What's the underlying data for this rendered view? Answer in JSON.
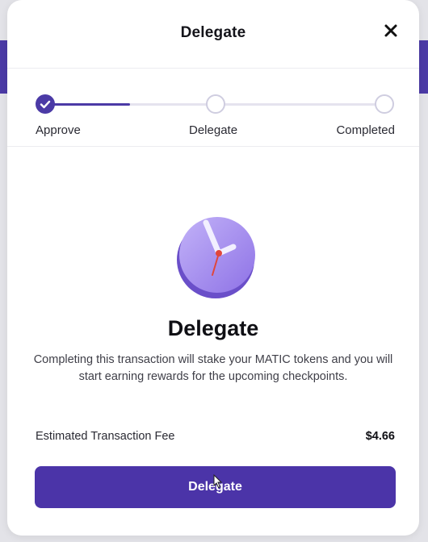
{
  "modal": {
    "title": "Delegate",
    "close_icon": "close-icon"
  },
  "stepper": {
    "steps": [
      {
        "label": "Approve",
        "status": "completed"
      },
      {
        "label": "Delegate",
        "status": "pending"
      },
      {
        "label": "Completed",
        "status": "pending"
      }
    ],
    "progress_fraction": 0.25
  },
  "content": {
    "illustration_icon": "clock-icon",
    "title": "Delegate",
    "description": "Completing this transaction will stake your MATIC tokens and you will start earning rewards for the upcoming checkpoints."
  },
  "fee": {
    "label": "Estimated Transaction Fee",
    "value": "$4.66"
  },
  "primary_button": {
    "label": "Delegate"
  },
  "colors": {
    "accent": "#4b34a8",
    "accent_light": "#a48ef0"
  }
}
